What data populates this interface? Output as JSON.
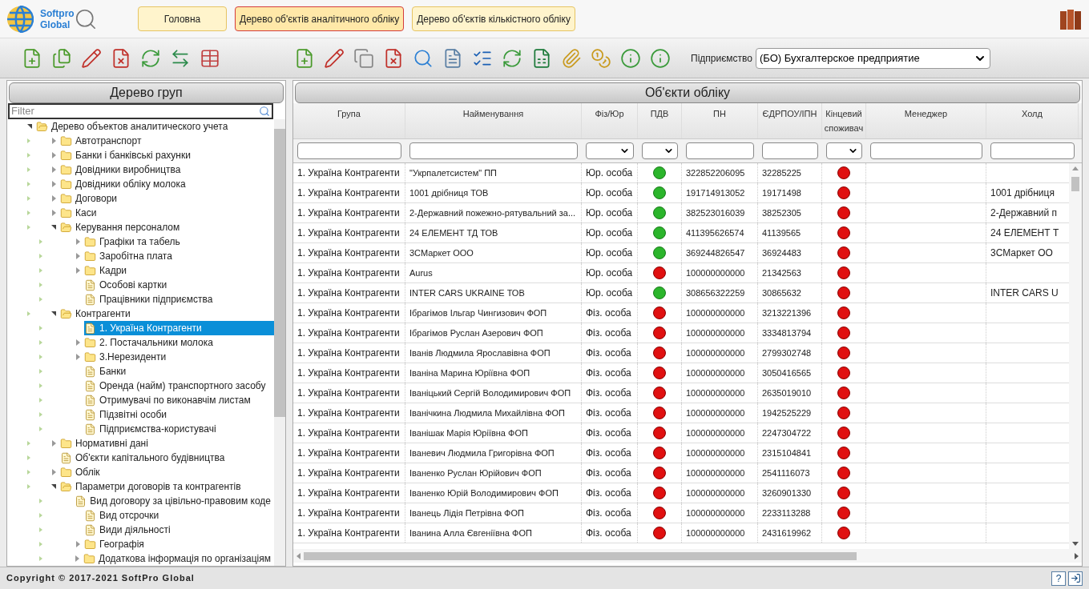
{
  "header": {
    "logo_text": [
      "Softpro",
      "Global"
    ],
    "tabs": [
      {
        "label": "Головна",
        "selected": false
      },
      {
        "label": "Дерево об'єктів аналітичного обліку",
        "selected": true
      },
      {
        "label": "Дерево об'єктів кількістного обліку",
        "selected": false
      }
    ]
  },
  "toolbar": {
    "enterprise_label": "Підприємство",
    "enterprise_value": "(БО) Бухгалтерское предприятие"
  },
  "tree_panel": {
    "title": "Дерево груп",
    "filter_placeholder": "Filter",
    "items": [
      {
        "label": "Дерево объектов аналитического учета",
        "kind": "folder",
        "expanded": true,
        "selected": false,
        "children": [
          {
            "label": "Автотранспорт",
            "kind": "folder",
            "expanded": false,
            "selected": false
          },
          {
            "label": "Банки і банківські рахунки",
            "kind": "folder",
            "expanded": false,
            "selected": false
          },
          {
            "label": "Довідники виробництва",
            "kind": "folder",
            "expanded": false,
            "selected": false
          },
          {
            "label": "Довідники обліку молока",
            "kind": "folder",
            "expanded": false,
            "selected": false
          },
          {
            "label": "Договори",
            "kind": "folder",
            "expanded": false,
            "selected": false
          },
          {
            "label": "Каси",
            "kind": "folder",
            "expanded": false,
            "selected": false
          },
          {
            "label": "Керування персоналом",
            "kind": "folder",
            "expanded": true,
            "selected": false,
            "children": [
              {
                "label": "Графіки та табель",
                "kind": "folder",
                "expanded": false,
                "selected": false
              },
              {
                "label": "Заробітна плата",
                "kind": "folder",
                "expanded": false,
                "selected": false
              },
              {
                "label": "Кадри",
                "kind": "folder",
                "expanded": false,
                "selected": false
              },
              {
                "label": "Особові картки",
                "kind": "doc",
                "selected": false
              },
              {
                "label": "Працівники підприємства",
                "kind": "doc",
                "selected": false
              }
            ]
          },
          {
            "label": "Контрагенти",
            "kind": "folder",
            "expanded": true,
            "selected": false,
            "children": [
              {
                "label": "1. Україна Контрагенти",
                "kind": "doc",
                "selected": true
              },
              {
                "label": "2. Постачальники молока",
                "kind": "folder",
                "expanded": false,
                "selected": false
              },
              {
                "label": "3.Нерезиденти",
                "kind": "folder",
                "expanded": false,
                "selected": false
              },
              {
                "label": "Банки",
                "kind": "doc",
                "selected": false
              },
              {
                "label": "Оренда (найм) транспортного засобу",
                "kind": "doc",
                "selected": false
              },
              {
                "label": "Отримувачі по виконавчім листам",
                "kind": "doc",
                "selected": false
              },
              {
                "label": "Підзвітні особи",
                "kind": "doc",
                "selected": false
              },
              {
                "label": "Підприємства-користувачі",
                "kind": "doc",
                "selected": false
              }
            ]
          },
          {
            "label": "Нормативні дані",
            "kind": "folder",
            "expanded": false,
            "selected": false
          },
          {
            "label": "Об'єкти капітального будівництва",
            "kind": "doc",
            "selected": false
          },
          {
            "label": "Облік",
            "kind": "folder",
            "expanded": false,
            "selected": false
          },
          {
            "label": "Параметри договорів та контрагентів",
            "kind": "folder",
            "expanded": true,
            "selected": false,
            "children": [
              {
                "label": "Вид договору за цівільно-правовим коде",
                "kind": "doc",
                "selected": false
              },
              {
                "label": "Вид отсрочки",
                "kind": "doc",
                "selected": false
              },
              {
                "label": "Види діяльності",
                "kind": "doc",
                "selected": false
              },
              {
                "label": "Географія",
                "kind": "folder",
                "expanded": false,
                "selected": false
              },
              {
                "label": "Додаткова інформація по організаціям",
                "kind": "folder",
                "expanded": false,
                "selected": false
              }
            ]
          }
        ]
      }
    ]
  },
  "table_panel": {
    "title": "Об'єкти обліку",
    "columns": [
      {
        "label": "Група",
        "kind": "text"
      },
      {
        "label": "Найменування",
        "kind": "text"
      },
      {
        "label": "Фіз/Юр",
        "kind": "select"
      },
      {
        "label": "ПДВ",
        "kind": "select"
      },
      {
        "label": "ПН",
        "kind": "text"
      },
      {
        "label": "ЄДРПОУ/ІПН",
        "kind": "text"
      },
      {
        "label": "Кінцевий споживач",
        "kind": "select"
      },
      {
        "label": "Менеджер",
        "kind": "text"
      },
      {
        "label": "Холд",
        "kind": "text"
      }
    ],
    "rows": [
      {
        "group": "1. Україна Контрагенти",
        "name": "\"Укрпалетсистем\" ПП",
        "type": "Юр. особа",
        "vat": true,
        "pn": "322852206095",
        "edrpou": "32285225",
        "end_consumer": false,
        "holding": ""
      },
      {
        "group": "1. Україна Контрагенти",
        "name": "1001 дрібниця ТОВ",
        "type": "Юр. особа",
        "vat": true,
        "pn": "191714913052",
        "edrpou": "19171498",
        "end_consumer": false,
        "holding": "1001 дрібниця"
      },
      {
        "group": "1. Україна Контрагенти",
        "name": "2-Державний пожежно-рятувальний за...",
        "type": "Юр. особа",
        "vat": true,
        "pn": "382523016039",
        "edrpou": "38252305",
        "end_consumer": false,
        "holding": "2-Державний п"
      },
      {
        "group": "1. Україна Контрагенти",
        "name": "24 ЕЛЕМЕНТ ТД ТОВ",
        "type": "Юр. особа",
        "vat": true,
        "pn": "411395626574",
        "edrpou": "41139565",
        "end_consumer": false,
        "holding": "24 ЕЛЕМЕНТ Т"
      },
      {
        "group": "1. Україна Контрагенти",
        "name": "3СМаркет ООО",
        "type": "Юр. особа",
        "vat": true,
        "pn": "369244826547",
        "edrpou": "36924483",
        "end_consumer": false,
        "holding": "3СМаркет ОО"
      },
      {
        "group": "1. Україна Контрагенти",
        "name": "Aurus",
        "type": "Юр. особа",
        "vat": false,
        "pn": "100000000000",
        "edrpou": "21342563",
        "end_consumer": false,
        "holding": ""
      },
      {
        "group": "1. Україна Контрагенти",
        "name": "INTER CARS UKRAINE ТОВ",
        "type": "Юр. особа",
        "vat": true,
        "pn": "308656322259",
        "edrpou": "30865632",
        "end_consumer": false,
        "holding": "INTER CARS U"
      },
      {
        "group": "1. Україна Контрагенти",
        "name": "Ібрагімов Ільгар Чингизович ФОП",
        "type": "Фіз. особа",
        "vat": false,
        "pn": "100000000000",
        "edrpou": "3213221396",
        "end_consumer": false,
        "holding": ""
      },
      {
        "group": "1. Україна Контрагенти",
        "name": "Ібрагімов Руслан Азерович ФОП",
        "type": "Фіз. особа",
        "vat": false,
        "pn": "100000000000",
        "edrpou": "3334813794",
        "end_consumer": false,
        "holding": ""
      },
      {
        "group": "1. Україна Контрагенти",
        "name": "Іванів Людмила Ярославівна ФОП",
        "type": "Фіз. особа",
        "vat": false,
        "pn": "100000000000",
        "edrpou": "2799302748",
        "end_consumer": false,
        "holding": ""
      },
      {
        "group": "1. Україна Контрагенти",
        "name": "Іваніна Марина Юріївна ФОП",
        "type": "Фіз. особа",
        "vat": false,
        "pn": "100000000000",
        "edrpou": "3050416565",
        "end_consumer": false,
        "holding": ""
      },
      {
        "group": "1. Україна Контрагенти",
        "name": "Іваніцький Сергій Володимирович ФОП",
        "type": "Фіз. особа",
        "vat": false,
        "pn": "100000000000",
        "edrpou": "2635019010",
        "end_consumer": false,
        "holding": ""
      },
      {
        "group": "1. Україна Контрагенти",
        "name": "Іванічкина Людмила Михайлівна ФОП",
        "type": "Фіз. особа",
        "vat": false,
        "pn": "100000000000",
        "edrpou": "1942525229",
        "end_consumer": false,
        "holding": ""
      },
      {
        "group": "1. Україна Контрагенти",
        "name": "Іванішак Марія Юріївна ФОП",
        "type": "Фіз. особа",
        "vat": false,
        "pn": "100000000000",
        "edrpou": "2247304722",
        "end_consumer": false,
        "holding": ""
      },
      {
        "group": "1. Україна Контрагенти",
        "name": "Іваневич Людмила Григорівна ФОП",
        "type": "Фіз. особа",
        "vat": false,
        "pn": "100000000000",
        "edrpou": "2315104841",
        "end_consumer": false,
        "holding": ""
      },
      {
        "group": "1. Україна Контрагенти",
        "name": "Іваненко Руслан Юрійович ФОП",
        "type": "Фіз. особа",
        "vat": false,
        "pn": "100000000000",
        "edrpou": "2541116073",
        "end_consumer": false,
        "holding": ""
      },
      {
        "group": "1. Україна Контрагенти",
        "name": "Іваненко Юрій Володимирович ФОП",
        "type": "Фіз. особа",
        "vat": false,
        "pn": "100000000000",
        "edrpou": "3260901330",
        "end_consumer": false,
        "holding": ""
      },
      {
        "group": "1. Україна Контрагенти",
        "name": "Іванець Лідія Петрівна ФОП",
        "type": "Фіз. особа",
        "vat": false,
        "pn": "100000000000",
        "edrpou": "2233113288",
        "end_consumer": false,
        "holding": ""
      },
      {
        "group": "1. Україна Контрагенти",
        "name": "Іванина Алла Євгеніївна ФОП",
        "type": "Фіз. особа",
        "vat": false,
        "pn": "100000000000",
        "edrpou": "2431619962",
        "end_consumer": false,
        "holding": ""
      }
    ]
  },
  "footer": {
    "copyright": "Copyright © 2017-2021 SoftPro Global",
    "help_button": "?"
  }
}
